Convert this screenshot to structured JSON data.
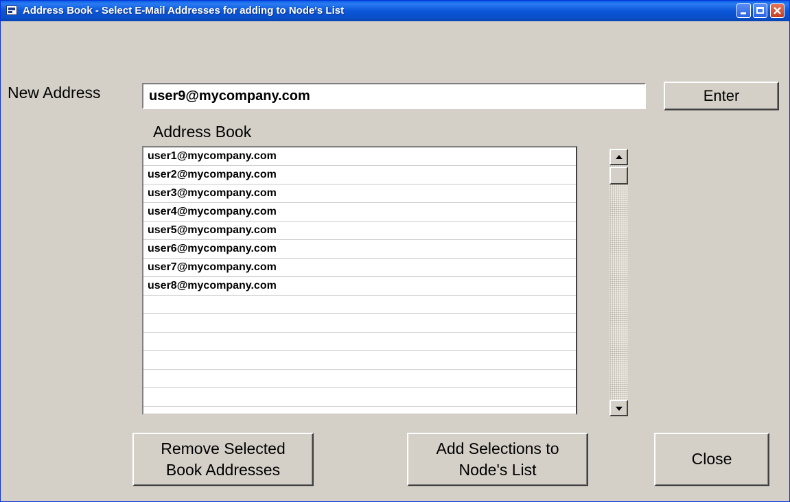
{
  "window": {
    "title": "Address Book - Select E-Mail Addresses for adding to Node's List"
  },
  "new_address": {
    "label": "New Address",
    "value": "user9@mycompany.com"
  },
  "buttons": {
    "enter": "Enter",
    "remove_line1": "Remove Selected",
    "remove_line2": "Book Addresses",
    "add_line1": "Add Selections to",
    "add_line2": "Node's List",
    "close": "Close"
  },
  "address_book": {
    "label": "Address Book",
    "items": [
      "user1@mycompany.com",
      "user2@mycompany.com",
      "user3@mycompany.com",
      "user4@mycompany.com",
      "user5@mycompany.com",
      "user6@mycompany.com",
      "user7@mycompany.com",
      "user8@mycompany.com",
      "",
      "",
      "",
      "",
      "",
      ""
    ]
  },
  "colors": {
    "face": "#d4d0c8",
    "titlebar": "#0a4ec6"
  },
  "icons": [
    "app-icon",
    "minimize-icon",
    "maximize-icon",
    "close-icon",
    "scroll-up-arrow-icon",
    "scroll-down-arrow-icon"
  ]
}
